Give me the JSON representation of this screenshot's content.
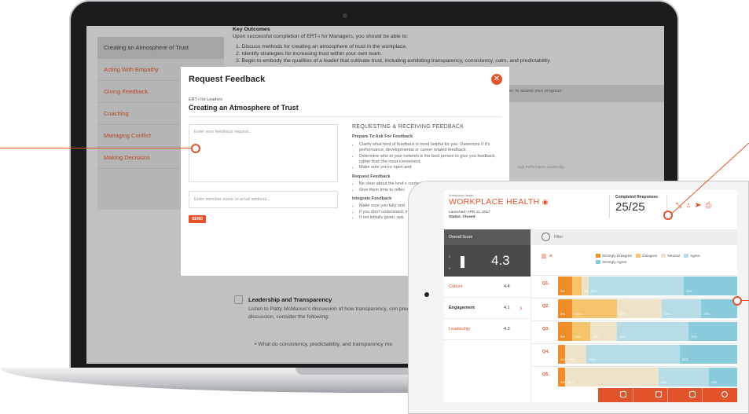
{
  "laptop": {
    "sidebar": {
      "items": [
        {
          "label": "Creating an Atmosphere of Trust",
          "active": true
        },
        {
          "label": "Acting With Empathy",
          "active": false
        },
        {
          "label": "Giving Feedback",
          "active": false
        },
        {
          "label": "Coaching",
          "active": false
        },
        {
          "label": "Managing Conflict",
          "active": false
        },
        {
          "label": "Making Decisions",
          "active": false
        }
      ]
    },
    "outcomes": {
      "heading": "Key Outcomes",
      "intro": "Upon successful completion of ERT-i for Managers, you should be able to:",
      "items": [
        "1. Discuss methods for creating an atmosphere of trust in the workplace.",
        "2. Identify strategies for increasing trust within your own team.",
        "3. Begin to embody the qualities of a leader that cultivate trust, including exhibiting transparency, consistency, calm, and predictability."
      ],
      "side_note": "ger, to assess your progress"
    },
    "modal": {
      "title": "Request Feedback",
      "close_icon": "close-icon",
      "course": "ERT-i for Leaders",
      "topic": "Creating an Atmosphere of Trust",
      "feedback_placeholder": "Enter your feedback request...",
      "member_placeholder": "Enter member name or email address...",
      "send_label": "SEND",
      "guide": {
        "heading": "REQUESTING & RECEIVING FEEDBACK",
        "sections": [
          {
            "title": "Prepare To Ask For Feedback",
            "bullets": [
              "Clarify what kind of feedback is most helpful for you. Determine if it's performance, developmental or career related feedback.",
              "Determine who in your network is the best person to give you feedback, rather than the most convenient.",
              "Make sure you're open and"
            ]
          },
          {
            "title": "Request Feedback",
            "bullets": [
              "Be clear about the kind o context for it.",
              "Give them time to reflec"
            ]
          },
          {
            "title": "Integrate Feedback",
            "bullets": [
              "Make sure you fully und",
              "If you don't understand, information or specific e",
              "If not initially given, ask"
            ]
          }
        ]
      },
      "behind_text": "High Performance Leadership"
    },
    "lower": {
      "heading": "Leadership and Transparency",
      "body": "Listen to Patty McManus's discussion of how transparency, con predictability feed into the leader's ability to create an environ to the discussion, consider the following:",
      "bullet": "What do consistency, predictability, and transparency me"
    }
  },
  "tablet": {
    "small_label": "Workplace Health",
    "title": "WORKPLACE HEALTH",
    "eye_icon": "eye-icon",
    "launched": "Launched:  APR 11, 2017",
    "status": "Status:  Closed",
    "completed_label": "Completed Responses",
    "completed_value": "25/25",
    "header_icons": [
      "chart-icon",
      "user-icon",
      "send-icon",
      "print-icon"
    ],
    "overall_label": "Overall Score",
    "overall_axis_top": "5",
    "overall_axis_bottom": "0",
    "overall_value": "4.3",
    "metrics": [
      {
        "name": "Culture",
        "value": "4.4"
      },
      {
        "name": "Engagement",
        "value": "4.1"
      },
      {
        "name": "Leadership",
        "value": "4.3"
      }
    ],
    "filter_label": "Filter",
    "colors": {
      "accent": "#e2532c",
      "dark": "#4a4a4a"
    }
  },
  "chart_data": {
    "type": "bar",
    "orientation": "horizontal",
    "stacked": true,
    "categories": [
      "Q1.",
      "Q2.",
      "Q3.",
      "Q4.",
      "Q5."
    ],
    "series": [
      {
        "name": "Strongly Disagree",
        "color": "#f08d2b",
        "values": [
          8,
          8,
          8,
          4,
          4
        ]
      },
      {
        "name": "Disagree",
        "color": "#f6c46a",
        "values": [
          5,
          25,
          10,
          0,
          0
        ]
      },
      {
        "name": "Neutral",
        "color": "#eee2c9",
        "values": [
          4,
          25,
          15,
          12,
          52
        ]
      },
      {
        "name": "Agree",
        "color": "#b6dde7",
        "values": [
          53,
          22,
          40,
          52,
          28
        ]
      },
      {
        "name": "Strongly Agree",
        "color": "#8acbdc",
        "values": [
          30,
          20,
          27,
          32,
          16
        ]
      }
    ],
    "data_labels": [
      [
        "8%",
        "",
        "4%",
        "53%",
        "30%"
      ],
      [
        "8%",
        "25%",
        "25%",
        "22%",
        "20%"
      ],
      [
        "8%",
        "10%",
        "15%",
        "40%",
        "27%"
      ],
      [
        "4%",
        "",
        "12%",
        "52%",
        "32%"
      ],
      [
        "4%",
        "",
        "52%",
        "28%",
        "16%"
      ]
    ]
  }
}
